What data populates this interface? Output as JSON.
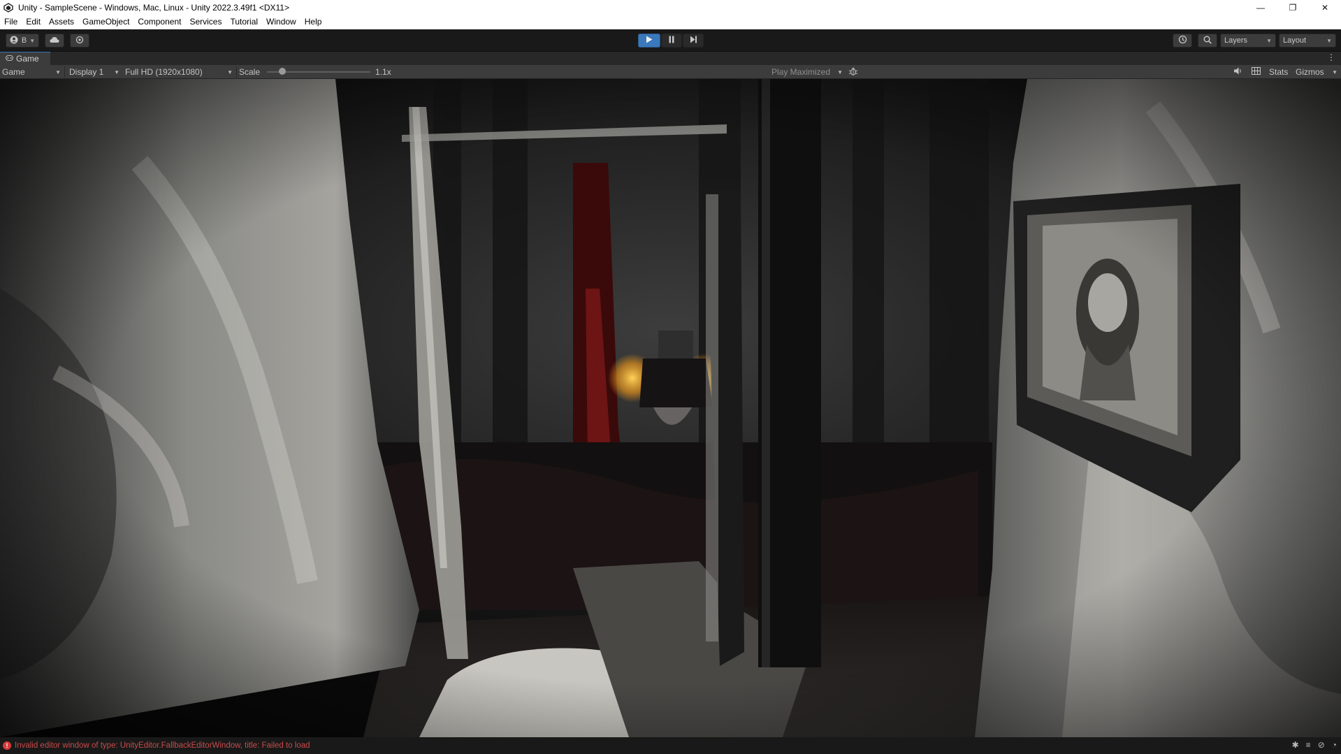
{
  "window": {
    "title": "Unity - SampleScene - Windows, Mac, Linux - Unity 2022.3.49f1 <DX11>",
    "minimize": "—",
    "restore": "❐",
    "close": "✕"
  },
  "menu": [
    "File",
    "Edit",
    "Assets",
    "GameObject",
    "Component",
    "Services",
    "Tutorial",
    "Window",
    "Help"
  ],
  "toolbar": {
    "account_label": "B",
    "play_state": "playing",
    "layers_label": "Layers",
    "layout_label": "Layout",
    "accent": "#3a79bb"
  },
  "game_view": {
    "tab_label": "Game",
    "mode_label": "Game",
    "display_label": "Display 1",
    "resolution_label": "Full HD (1920x1080)",
    "scale_label": "Scale",
    "scale_value_label": "1.1x",
    "scale_value": 1.1,
    "play_maximized_label": "Play Maximized",
    "stats_label": "Stats",
    "gizmos_label": "Gizmos"
  },
  "status": {
    "error_message": "Invalid editor window of type: UnityEditor.FallbackEditorWindow, title: Failed to load",
    "error_color": "#c94a4a"
  },
  "icons": {
    "unity_logo": "unity-logo-icon",
    "account": "account-icon",
    "cloud": "cloud-icon",
    "collab": "collab-icon",
    "play": "play-icon",
    "pause": "pause-icon",
    "step": "step-icon",
    "history": "history-icon",
    "search": "search-icon",
    "audio": "speaker-icon",
    "aspect": "grid-icon",
    "bug": "bug-icon"
  }
}
